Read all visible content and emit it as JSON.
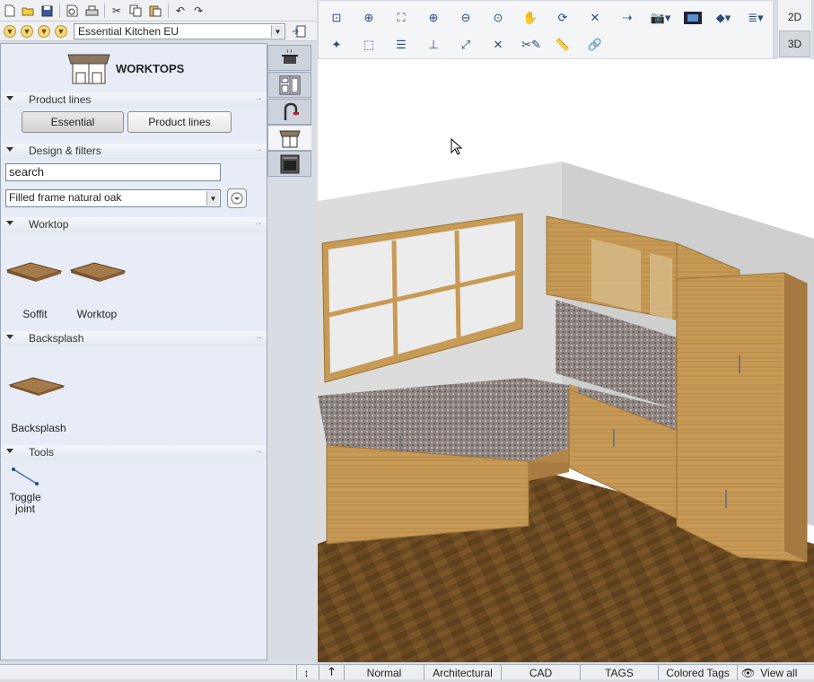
{
  "toolbar_left": {
    "icons": [
      "new-icon",
      "open-icon",
      "save-icon",
      "print-preview-icon",
      "print-icon",
      "cut-icon",
      "copy-icon",
      "paste-icon",
      "undo-icon",
      "redo-icon"
    ]
  },
  "catalog": {
    "selected": "Essential Kitchen EU"
  },
  "panel": {
    "title": "WORKTOPS",
    "sections": {
      "product_lines": "Product lines",
      "design_filters": "Design & filters",
      "worktop": "Worktop",
      "backsplash": "Backsplash",
      "tools": "Tools"
    },
    "buttons": {
      "essential": "Essential",
      "product_lines": "Product lines"
    },
    "search_value": "search",
    "filter_selected": "Filled frame natural oak",
    "worktop_items": [
      "Soffit",
      "Worktop"
    ],
    "backsplash_items": [
      "Backsplash"
    ],
    "tool_items": [
      "Toggle\njoint"
    ]
  },
  "view_modes": {
    "two_d": "2D",
    "three_d": "3D"
  },
  "status_bar": {
    "tabs": [
      "Normal",
      "Architectural",
      "CAD",
      "TAGS",
      "Colored Tags",
      "View all"
    ]
  },
  "colors": {
    "panel_bg": "#e8ecf7",
    "wood": "#c79a55",
    "floor": "#6b4a22",
    "wall": "#dcdcdc",
    "granite": "#8f8684"
  }
}
